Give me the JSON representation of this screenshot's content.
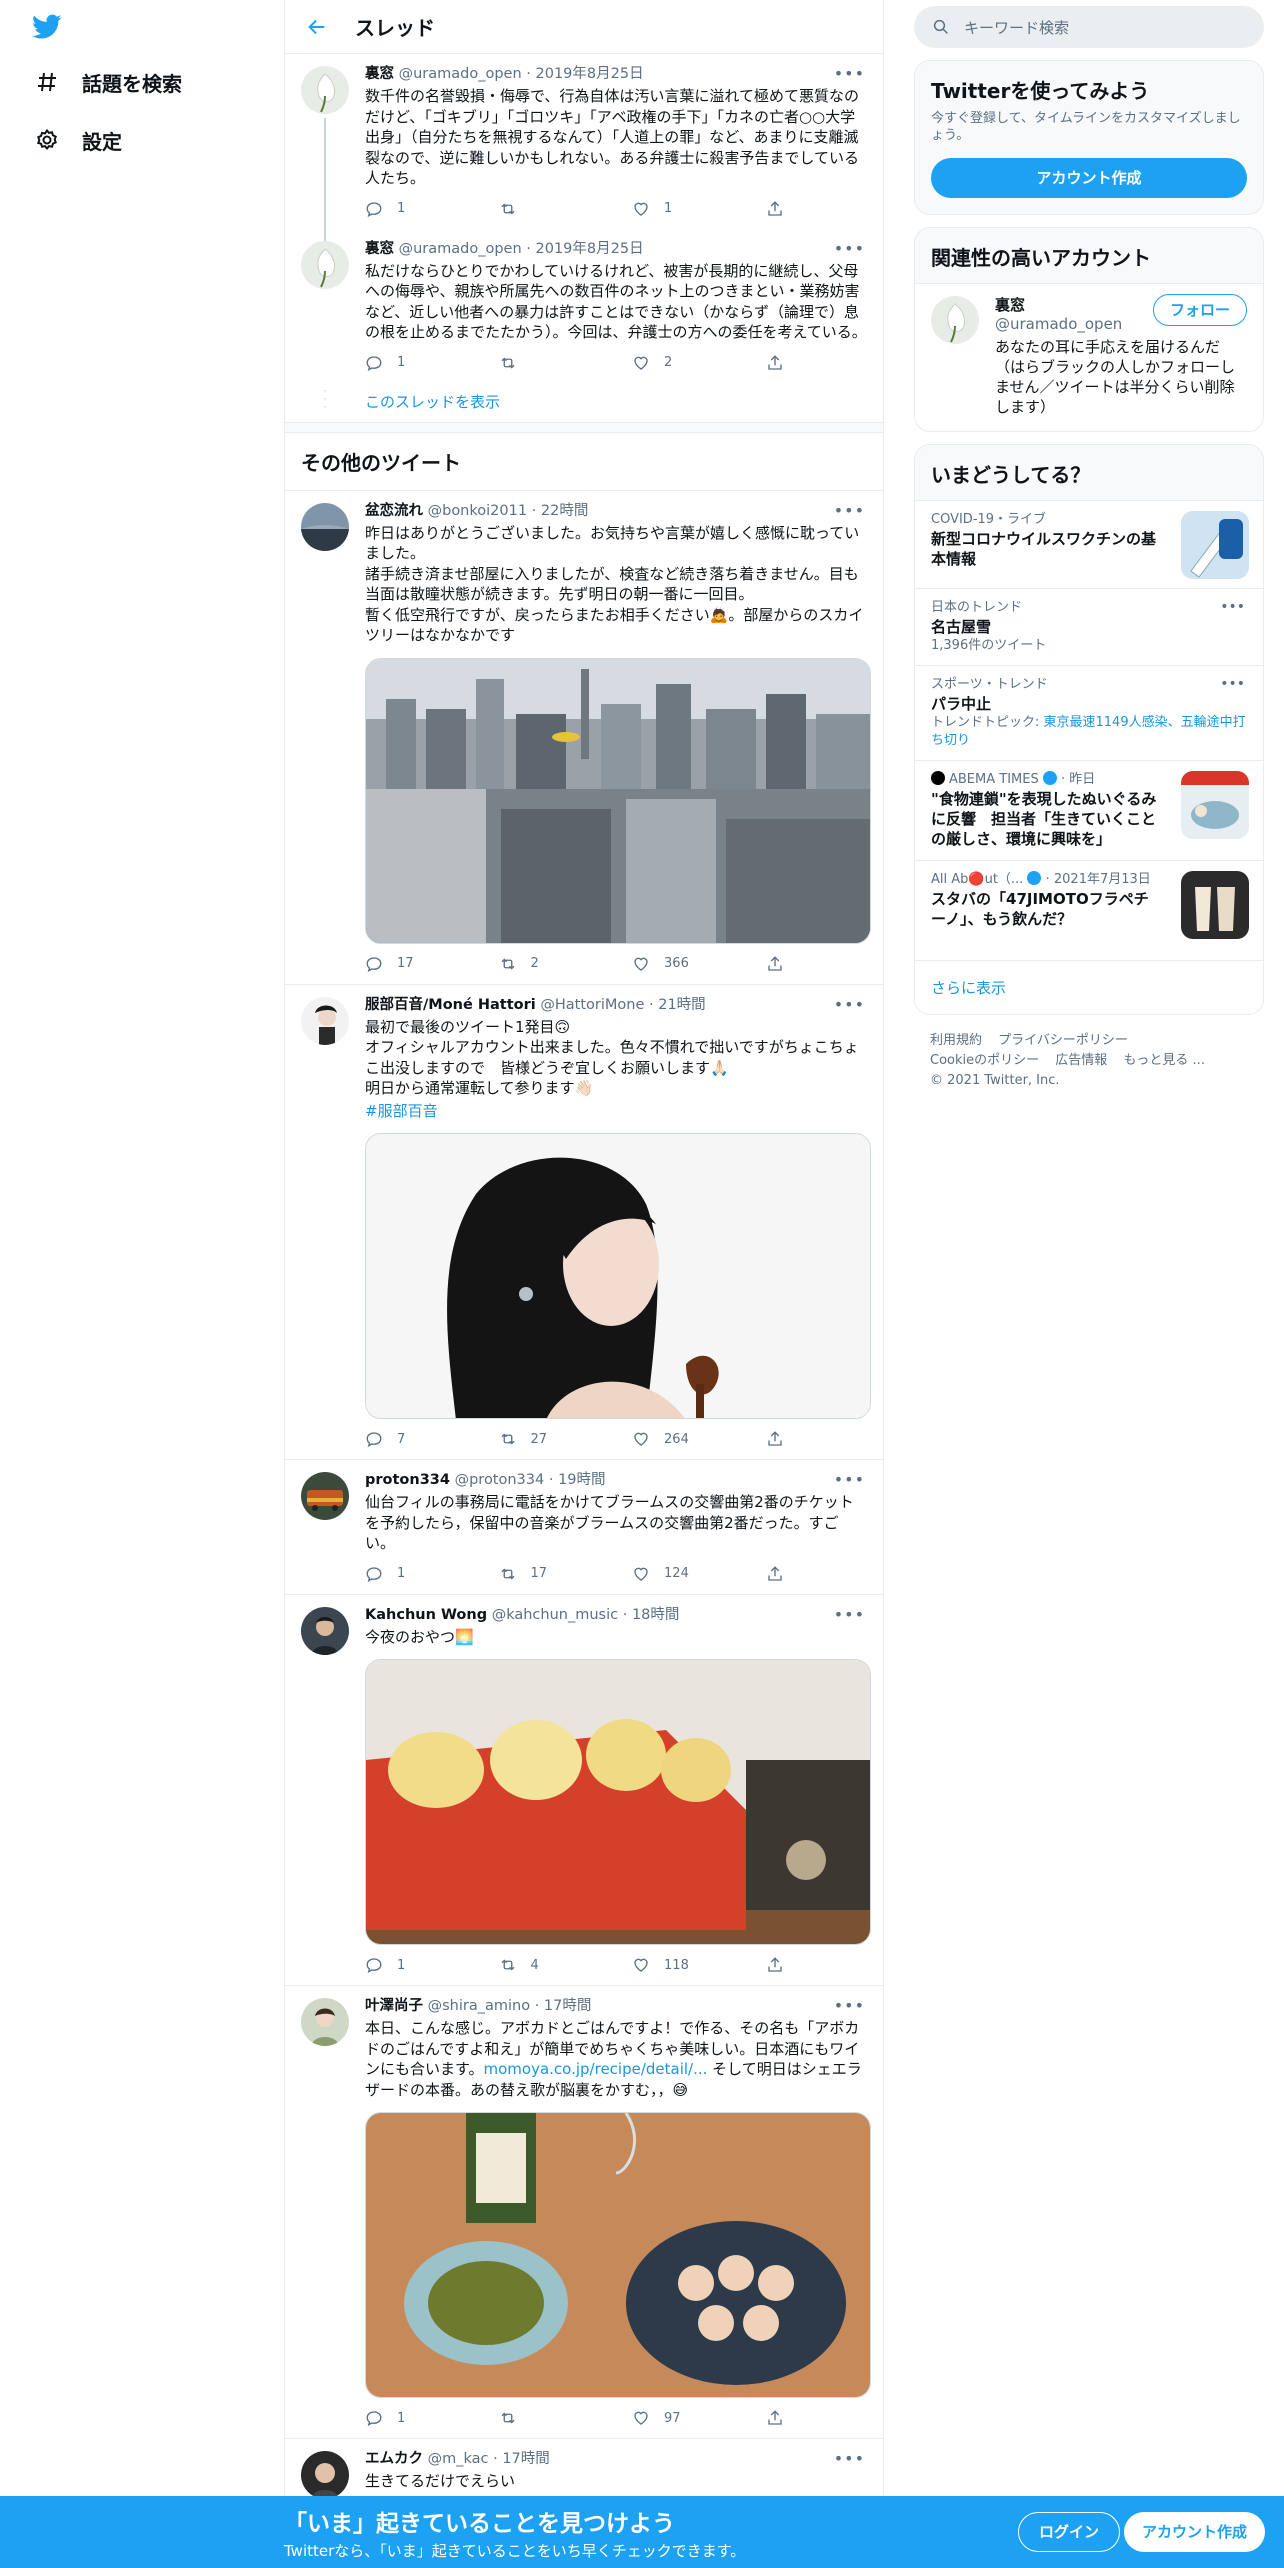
{
  "nav": {
    "explore_label": "話題を検索",
    "settings_label": "設定"
  },
  "header": {
    "title": "スレッド"
  },
  "thread_tweets": [
    {
      "name": "裏窓",
      "handle": "@uramado_open",
      "time": "2019年8月25日",
      "text": "数千件の名誉毀損・侮辱で、行為自体は汚い言葉に溢れて極めて悪質なのだけど、「ゴキブリ」「ゴロツキ」「アベ政権の手下」「カネの亡者○○大学出身」（自分たちを無視するなんて）「人道上の罪」など、あまりに支離滅裂なので、逆に難しいかもしれない。ある弁護士に殺害予告までしている人たち。",
      "replies": "1",
      "retweets": "",
      "likes": "1"
    },
    {
      "name": "裏窓",
      "handle": "@uramado_open",
      "time": "2019年8月25日",
      "text": "私だけならひとりでかわしていけるけれど、被害が長期的に継続し、父母への侮辱や、親族や所属先への数百件のネット上のつきまとい・業務妨害など、近しい他者への暴力は許すことはできない（かならず（論理で）息の根を止めるまでたたかう）。今回は、弁護士の方への委任を考えている。",
      "replies": "1",
      "retweets": "",
      "likes": "2"
    }
  ],
  "show_thread_label": "このスレッドを表示",
  "other_tweets_title": "その他のツイート",
  "other_tweets": [
    {
      "name": "盆恋流れ",
      "handle": "@bonkoi2011",
      "time": "22時間",
      "text": "昨日はありがとうございました。お気持ちや言葉が嬉しく感慨に耽っていました。\n諸手続き済ませ部屋に入りましたが、検査など続き落ち着きません。目も当面は散瞳状態が続きます。先ず明日の朝一番に一回目。\n暫く低空飛行ですが、戻ったらまたお相手ください🙇。部屋からのスカイツリーはなかなかです",
      "replies": "17",
      "retweets": "2",
      "likes": "366"
    },
    {
      "name": "服部百音/Moné Hattori",
      "handle": "@HattoriMone",
      "time": "21時間",
      "text": "最初で最後のツイート1発目🙃\nオフィシャルアカウント出来ました。色々不慣れで拙いですがちょこちょこ出没しますので　皆様どうぞ宜しくお願いします🙏🏻\n明日から通常運転して参ります👋🏻",
      "hashtag": "#服部百音",
      "replies": "7",
      "retweets": "27",
      "likes": "264"
    },
    {
      "name": "proton334",
      "handle": "@proton334",
      "time": "19時間",
      "text": "仙台フィルの事務局に電話をかけてブラームスの交響曲第2番のチケットを予約したら，保留中の音楽がブラームスの交響曲第2番だった。すごい。",
      "replies": "1",
      "retweets": "17",
      "likes": "124"
    },
    {
      "name": "Kahchun Wong",
      "handle": "@kahchun_music",
      "time": "18時間",
      "text": "今夜のおやつ🌅",
      "replies": "1",
      "retweets": "4",
      "likes": "118"
    },
    {
      "name": "叶澤尚子",
      "handle": "@shira_amino",
      "time": "17時間",
      "text_before": "本日、こんな感じ。アボカドとごはんですよ！で作る、その名も「アボカドのごはんですよ和え」が簡単でめちゃくちゃ美味しい。日本酒にもワインにも合います。",
      "link": "momoya.co.jp/recipe/detail/...",
      "text_after": " そして明日はシェエラザードの本番。あの替え歌が脳裏をかすむ，，😅",
      "replies": "1",
      "retweets": "",
      "likes": "97"
    },
    {
      "name": "エムカク",
      "handle": "@m_kac",
      "time": "17時間",
      "text": "生きてるだけでえらい"
    }
  ],
  "sidebar": {
    "search_placeholder": "キーワード検索",
    "signup_card": {
      "title": "Twitterを使ってみよう",
      "subtitle": "今すぐ登録して、タイムラインをカスタマイズしましょう。",
      "button": "アカウント作成"
    },
    "relevant": {
      "title": "関連性の高いアカウント",
      "name": "裏窓",
      "handle": "@uramado_open",
      "bio": "あなたの耳に手応えを届けるんだ（はらブラックの人しかフォローしません／ツイートは半分くらい削除します）",
      "follow_label": "フォロー"
    },
    "trends": {
      "title": "いまどうしてる？",
      "items": [
        {
          "meta": "COVID-19・ライブ",
          "title": "新型コロナウイルスワクチンの基本情報"
        },
        {
          "meta": "日本のトレンド",
          "title": "名古屋雪",
          "extra": "1,396件のツイート"
        },
        {
          "meta": "スポーツ・トレンド",
          "title": "パラ中止",
          "extra_prefix": "トレンドトピック: ",
          "extra_link": "東京最速1149人感染、五輪途中打ち切り"
        },
        {
          "meta": "ABEMA TIMES",
          "meta_time": "昨日",
          "title": "\"食物連鎖\"を表現したぬいぐるみに反響　担当者「生きていくことの厳しさ、環境に興味を」"
        },
        {
          "meta": "All Ab🔴ut（...",
          "meta_time": "2021年7月13日",
          "title": "スタバの「47JIMOTOフラペチーノ」、もう飲んだ？"
        }
      ],
      "show_more": "さらに表示"
    },
    "footer": {
      "terms": "利用規約",
      "privacy": "プライバシーポリシー",
      "cookie": "Cookieのポリシー",
      "ads": "広告情報",
      "more": "もっと見る ...",
      "copyright": "© 2021 Twitter, Inc."
    }
  },
  "bottom_bar": {
    "title": "「いま」起きていることを見つけよう",
    "subtitle": "Twitterなら、「いま」起きていることをいち早くチェックできます。",
    "login": "ログイン",
    "signup": "アカウント作成"
  },
  "colors": {
    "brand": "#1da1f2",
    "link": "#1b95e0",
    "secondary_text": "#5b7083"
  }
}
